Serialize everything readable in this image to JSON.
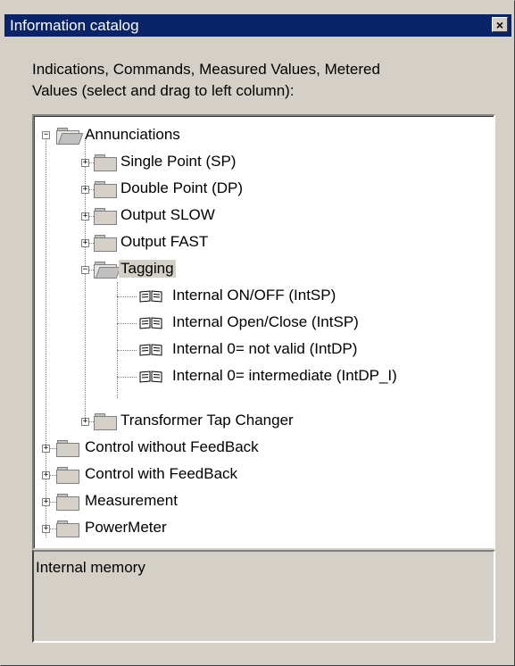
{
  "window": {
    "title": "Information catalog",
    "close_glyph": "×"
  },
  "instructions": {
    "line1": "Indications, Commands, Measured Values, Metered",
    "line2": "Values (select and drag to left column):"
  },
  "tree": {
    "root": {
      "label": "Annunciations",
      "expanded": true,
      "children": [
        {
          "label": "Single Point (SP)",
          "expanded": false
        },
        {
          "label": "Double Point (DP)",
          "expanded": false
        },
        {
          "label": "Output SLOW",
          "expanded": false
        },
        {
          "label": "Output FAST",
          "expanded": false
        },
        {
          "label": "Tagging",
          "expanded": true,
          "selected": true,
          "items": [
            {
              "label": "Internal ON/OFF (IntSP)",
              "icon": "book-icon"
            },
            {
              "label": "Internal Open/Close (IntSP)",
              "icon": "book-icon"
            },
            {
              "label": "Internal 0= not valid (IntDP)",
              "icon": "book-icon"
            },
            {
              "label": "Internal 0= intermediate (IntDP_I)",
              "icon": "book-icon"
            }
          ]
        },
        {
          "label": "Transformer Tap Changer",
          "expanded": false
        }
      ]
    },
    "top_level": [
      {
        "label": "Control without FeedBack",
        "expanded": false
      },
      {
        "label": "Control with FeedBack",
        "expanded": false
      },
      {
        "label": "Measurement",
        "expanded": false
      },
      {
        "label": "PowerMeter",
        "expanded": false
      }
    ],
    "expand_glyph": "+",
    "collapse_glyph": "−"
  },
  "status": {
    "text": "Internal memory"
  },
  "colors": {
    "titlebar": "#0a246a",
    "window_bg": "#d4d0c8",
    "tree_bg": "#ffffff"
  }
}
